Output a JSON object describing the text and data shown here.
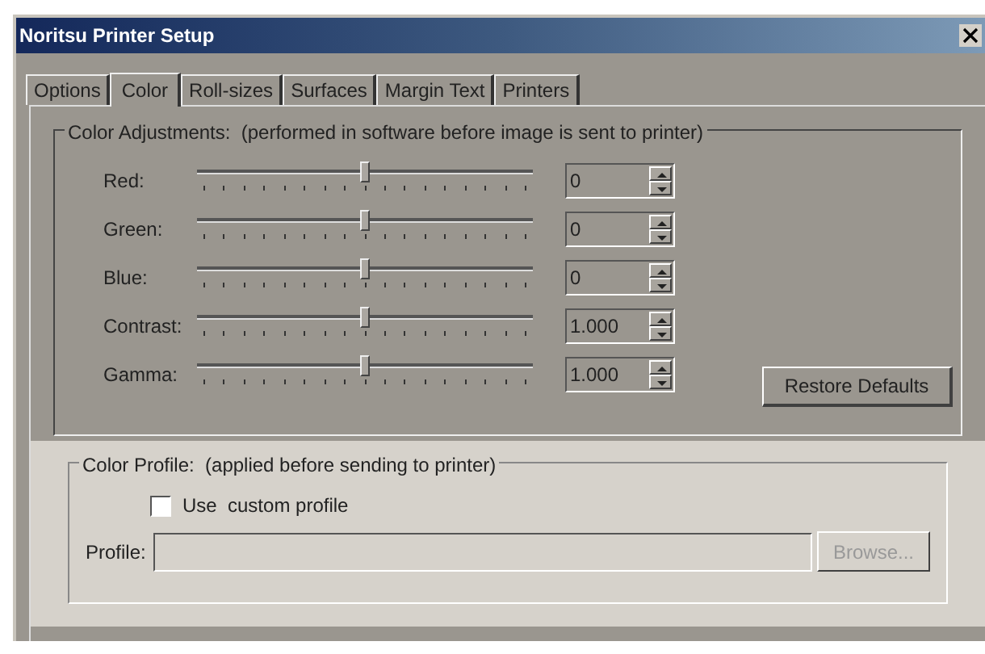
{
  "window": {
    "title": "Noritsu Printer Setup"
  },
  "tabs": [
    {
      "label": "Options",
      "selected": false
    },
    {
      "label": "Color",
      "selected": true
    },
    {
      "label": "Roll-sizes",
      "selected": false
    },
    {
      "label": "Surfaces",
      "selected": false
    },
    {
      "label": "Margin Text",
      "selected": false
    },
    {
      "label": "Printers",
      "selected": false
    }
  ],
  "color_adjustments": {
    "title": "Color Adjustments:  (performed in software before image is sent to printer)",
    "sliders": [
      {
        "label": "Red:",
        "level": 0.5,
        "value": "0"
      },
      {
        "label": "Green:",
        "level": 0.5,
        "value": "0"
      },
      {
        "label": "Blue:",
        "level": 0.5,
        "value": "0"
      },
      {
        "label": "Contrast:",
        "level": 0.5,
        "value": "1.000"
      },
      {
        "label": "Gamma:",
        "level": 0.5,
        "value": "1.000"
      }
    ],
    "restore_button": "Restore Defaults"
  },
  "color_profile": {
    "title": "Color Profile:  (applied before sending to printer)",
    "checkbox": {
      "label": "Use  custom profile",
      "checked": false
    },
    "profile_label": "Profile:",
    "browse_button": {
      "label": "Browse...",
      "disabled": true
    }
  }
}
